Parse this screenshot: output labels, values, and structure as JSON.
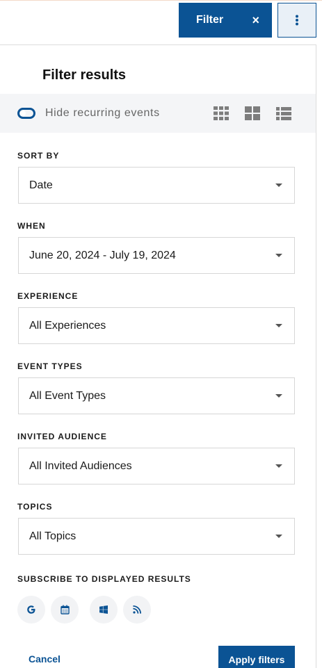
{
  "header": {
    "filter_button_label": "Filter",
    "close_glyph": "×",
    "more_icon": "more-vertical-icon"
  },
  "panel": {
    "title": "Filter results",
    "toggle_label": "Hide recurring events",
    "toggle_on": false,
    "view_icons": [
      "grid-small-icon",
      "grid-large-icon",
      "list-icon"
    ]
  },
  "filters": {
    "sort_by": {
      "label": "SORT BY",
      "value": "Date"
    },
    "when": {
      "label": "WHEN",
      "value": "June 20, 2024 - July 19, 2024"
    },
    "experience": {
      "label": "EXPERIENCE",
      "value": "All Experiences"
    },
    "event_types": {
      "label": "EVENT TYPES",
      "value": "All Event Types"
    },
    "invited_audience": {
      "label": "INVITED AUDIENCE",
      "value": "All Invited Audiences"
    },
    "topics": {
      "label": "TOPICS",
      "value": "All Topics"
    }
  },
  "subscribe": {
    "label": "SUBSCRIBE TO DISPLAYED RESULTS",
    "icons": [
      "google-icon",
      "calendar-icon",
      "windows-icon",
      "rss-icon"
    ]
  },
  "footer": {
    "cancel_label": "Cancel",
    "apply_label": "Apply filters"
  },
  "colors": {
    "accent": "#0b5394",
    "icon_gray": "#7d7d7d",
    "panel_bg_light": "#f4f5f7"
  }
}
